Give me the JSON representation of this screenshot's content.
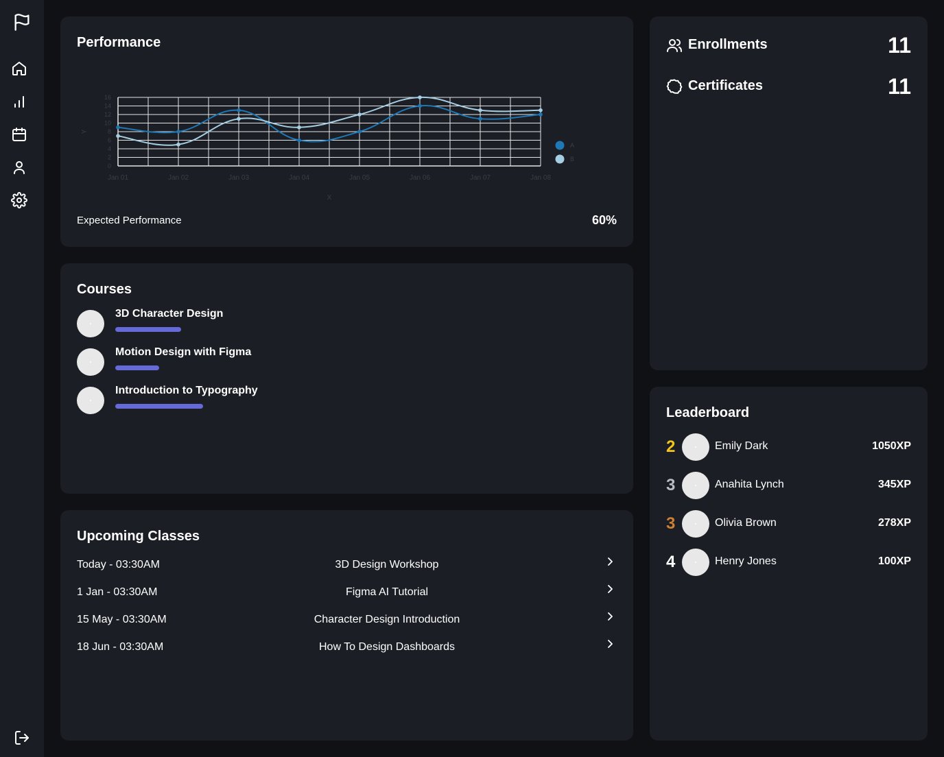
{
  "colors": {
    "background": "#101114",
    "sidebar": "#1a1d23",
    "card": "#1b1e24",
    "accent_bar": "#6669d8",
    "series_a": "#1f77b4",
    "series_b": "#a6cee3",
    "rank_gold": "#f5c518",
    "rank_silver": "#b8bcc4",
    "rank_bronze": "#cd7f32",
    "rank_default": "#ffffff"
  },
  "sidebar": {
    "logo_icon": "flag-icon",
    "items": [
      {
        "icon": "home-icon"
      },
      {
        "icon": "bar-chart-icon"
      },
      {
        "icon": "calendar-icon"
      },
      {
        "icon": "user-icon"
      },
      {
        "icon": "gear-icon"
      }
    ],
    "logout_icon": "logout-icon"
  },
  "performance": {
    "title": "Performance",
    "footer_label": "Expected Performance",
    "footer_value": "60%"
  },
  "chart_data": {
    "type": "line",
    "title": "",
    "xlabel": "X",
    "ylabel": "Y",
    "categories": [
      "Jan 01",
      "Jan 02",
      "Jan 03",
      "Jan 04",
      "Jan 05",
      "Jan 06",
      "Jan 07",
      "Jan 08"
    ],
    "yticks": [
      0,
      2,
      4,
      6,
      8,
      10,
      12,
      14,
      16
    ],
    "ylim": [
      0,
      16
    ],
    "grid": true,
    "legend": "right",
    "series": [
      {
        "name": "A",
        "values": [
          9,
          8,
          13,
          6,
          8,
          14,
          11,
          12
        ]
      },
      {
        "name": "B",
        "values": [
          7,
          5,
          11,
          9,
          12,
          16,
          13,
          13
        ]
      }
    ]
  },
  "courses": {
    "title": "Courses",
    "items": [
      {
        "name": "3D Character Design",
        "progress": 0.75
      },
      {
        "name": "Motion Design with Figma",
        "progress": 0.5
      },
      {
        "name": "Introduction to Typography",
        "progress": 1.0
      }
    ]
  },
  "upcoming": {
    "title": "Upcoming Classes",
    "items": [
      {
        "date": "Today - 03:30AM",
        "name": "3D Design Workshop"
      },
      {
        "date": "1 Jan - 03:30AM",
        "name": "Figma AI Tutorial"
      },
      {
        "date": "15 May - 03:30AM",
        "name": "Character Design Introduction"
      },
      {
        "date": "18 Jun - 03:30AM",
        "name": "How To Design Dashboards"
      }
    ]
  },
  "stats": {
    "enrollments": {
      "label": "Enrollments",
      "value": "11",
      "icon": "users-icon"
    },
    "certificates": {
      "label": "Certificates",
      "value": "11",
      "icon": "certificate-icon"
    }
  },
  "leaderboard": {
    "title": "Leaderboard",
    "items": [
      {
        "rank": "2",
        "name": "Emily Dark",
        "xp": "1050XP",
        "rank_color": "#f5c518"
      },
      {
        "rank": "3",
        "name": "Anahita Lynch",
        "xp": "345XP",
        "rank_color": "#b8bcc4"
      },
      {
        "rank": "3",
        "name": "Olivia Brown",
        "xp": "278XP",
        "rank_color": "#cd7f32"
      },
      {
        "rank": "4",
        "name": "Henry Jones",
        "xp": "100XP",
        "rank_color": "#ffffff"
      }
    ]
  }
}
